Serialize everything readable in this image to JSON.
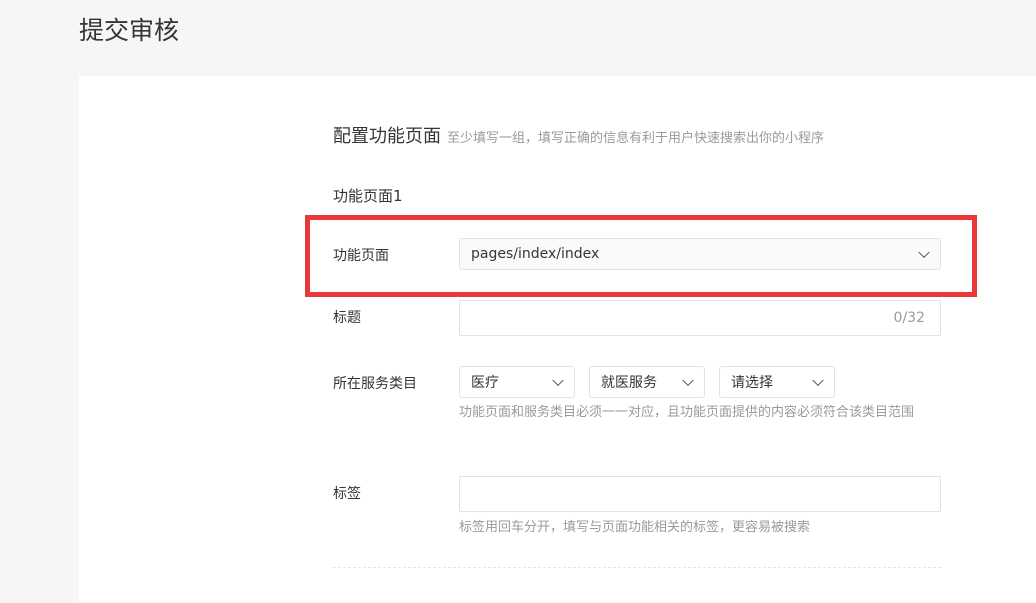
{
  "page": {
    "title": "提交审核"
  },
  "section": {
    "title": "配置功能页面",
    "hint": "至少填写一组，填写正确的信息有利于用户快速搜索出你的小程序"
  },
  "group": {
    "title": "功能页面1",
    "page_field": {
      "label": "功能页面",
      "value": "pages/index/index"
    },
    "title_field": {
      "label": "标题",
      "value": "",
      "counter": "0/32"
    },
    "category_field": {
      "label": "所在服务类目",
      "level1": "医疗",
      "level2": "就医服务",
      "level3": "请选择",
      "hint": "功能页面和服务类目必须一一对应，且功能页面提供的内容必须符合该类目范围"
    },
    "tags_field": {
      "label": "标签",
      "value": "",
      "hint": "标签用回车分开，填写与页面功能相关的标签，更容易被搜索"
    }
  },
  "colors": {
    "highlight": "#e93838",
    "hint_text": "#9a9a9a",
    "text": "#353535"
  },
  "icons": {
    "dropdown": "chevron-down-icon"
  }
}
